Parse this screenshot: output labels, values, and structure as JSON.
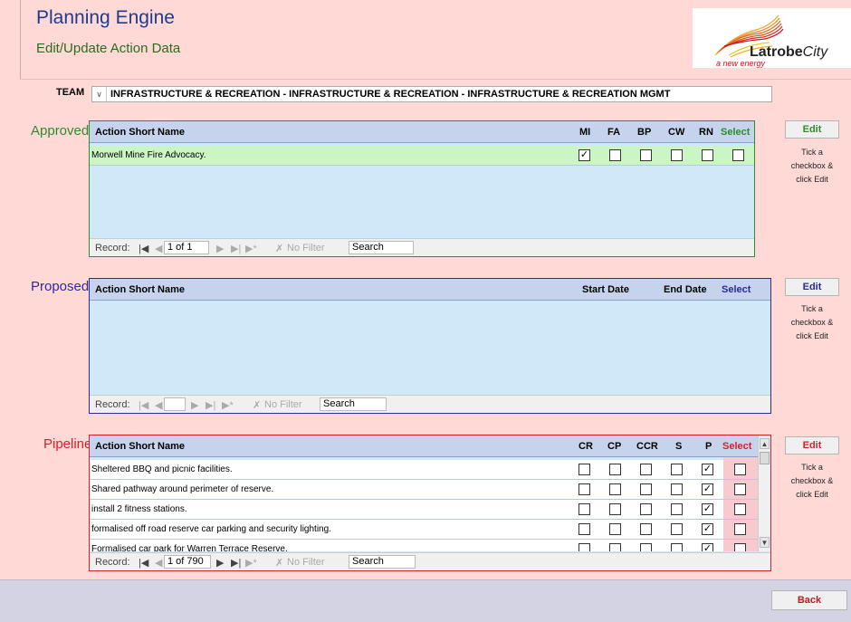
{
  "header": {
    "app_title": "Planning Engine",
    "subtitle": "Edit/Update Action Data",
    "logo_main": "Latrobe",
    "logo_city": "City",
    "logo_tagline": "a new energy"
  },
  "team": {
    "label": "TEAM",
    "value": "INFRASTRUCTURE & RECREATION  -  INFRASTRUCTURE & RECREATION  -  INFRASTRUCTURE & RECREATION MGMT"
  },
  "approved": {
    "label": "Approved",
    "columns": {
      "name": "Action Short Name",
      "mi": "MI",
      "fa": "FA",
      "bp": "BP",
      "cw": "CW",
      "rn": "RN",
      "select": "Select"
    },
    "rows": [
      {
        "name": "Morwell Mine Fire Advocacy.",
        "checks": [
          true,
          false,
          false,
          false,
          false,
          false
        ]
      }
    ],
    "nav": {
      "record_label": "Record:",
      "position": "1 of 1",
      "filter": "No Filter",
      "search": "Search"
    },
    "edit_label": "Edit",
    "hint": "Tick a checkbox & click Edit"
  },
  "proposed": {
    "label": "Proposed",
    "columns": {
      "name": "Action Short Name",
      "start": "Start Date",
      "end": "End Date",
      "select": "Select"
    },
    "nav": {
      "record_label": "Record:",
      "position": "",
      "filter": "No Filter",
      "search": "Search"
    },
    "edit_label": "Edit",
    "hint": "Tick a checkbox & click Edit"
  },
  "pipeline": {
    "label": "Pipeline",
    "columns": {
      "name": "Action Short Name",
      "cr": "CR",
      "cp": "CP",
      "ccr": "CCR",
      "s": "S",
      "p": "P",
      "select": "Select"
    },
    "rows": [
      {
        "name": "Sheltered BBQ and picnic facilities.",
        "checks": [
          false,
          false,
          false,
          false,
          true,
          false
        ]
      },
      {
        "name": "Shared pathway around perimeter of reserve.",
        "checks": [
          false,
          false,
          false,
          false,
          true,
          false
        ]
      },
      {
        "name": "install 2 fitness stations.",
        "checks": [
          false,
          false,
          false,
          false,
          true,
          false
        ]
      },
      {
        "name": "formalised off road reserve car parking and security lighting.",
        "checks": [
          false,
          false,
          false,
          false,
          true,
          false
        ]
      },
      {
        "name": "Formalised car park for Warren Terrace Reserve.",
        "checks": [
          false,
          false,
          false,
          false,
          true,
          false
        ]
      }
    ],
    "nav": {
      "record_label": "Record:",
      "position": "1 of 790",
      "filter": "No Filter",
      "search": "Search"
    },
    "edit_label": "Edit",
    "hint": "Tick a checkbox & click Edit"
  },
  "footer": {
    "back_label": "Back"
  },
  "colors": {
    "approved": "#2e8b2e",
    "proposed": "#2b2b9e",
    "pipeline": "#d2232a",
    "pipeline_select_bg": "#f9c9d0",
    "approved_row_bg": "#ccf5c6"
  }
}
